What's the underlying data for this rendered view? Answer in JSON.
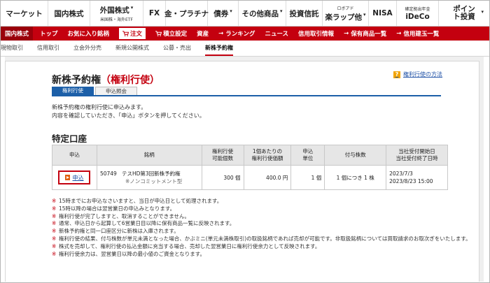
{
  "topnav": [
    {
      "label": "マーケット"
    },
    {
      "label": "国内株式"
    },
    {
      "label": "外国株式",
      "sub": "米国株・海外ETF"
    },
    {
      "label": "FX"
    },
    {
      "label": "金・プラチナ"
    },
    {
      "label": "債券"
    },
    {
      "label": "その他商品"
    },
    {
      "label": "投資信託"
    },
    {
      "label": "楽ラップ他",
      "sub2": "ロボアド"
    },
    {
      "label": "NISA"
    },
    {
      "label": "iDeCo",
      "sub2": "確定拠出年金"
    },
    {
      "label": "ポイント投資"
    }
  ],
  "rednav": {
    "home": "国内株式",
    "items": [
      "トップ",
      "お気に入り銘柄",
      "注文",
      "積立設定",
      "資産",
      "ランキング",
      "ニュース",
      "信用取引情報",
      "保有商品一覧",
      "信用建玉一覧"
    ]
  },
  "subnav": {
    "items": [
      "現物取引",
      "信用取引",
      "立会外分売",
      "新規公開株式",
      "公募・売出",
      "新株予約権"
    ]
  },
  "page": {
    "title_main": "新株予約権",
    "title_accent": "（権利行使）",
    "help_label": "権利行使の方法",
    "tabs": [
      "権利行使",
      "申込照会"
    ],
    "instructions": [
      "新株予約権の権利行使に申込みます。",
      "内容を確認していただき、「申込」ボタンを押してください。"
    ],
    "section_title": "特定口座"
  },
  "table": {
    "headers": {
      "apply": "申込",
      "name": "銘柄",
      "avail_l1": "権利行使",
      "avail_l2": "可能個数",
      "price_l1": "1個あたりの",
      "price_l2": "権利行使価額",
      "unit_l1": "申込",
      "unit_l2": "単位",
      "grant": "付与株数",
      "dates_l1": "当社受付開始日",
      "dates_l2": "当社受付終了日時"
    },
    "row": {
      "apply_label": "申込",
      "code": "50749",
      "name": "テスHD第3回新株予約権",
      "note": "※ノンコミットメント型",
      "avail": "300 個",
      "price": "400.0 円",
      "unit": "1 個",
      "grant": "1 個につき 1 株",
      "start": "2023/7/3",
      "end": "2023/8/23 15:00"
    }
  },
  "notes": [
    "15時までにお申込なさいますと、当日が申込日として処理されます。",
    "15時以降の場合は翌営業日の申込みとなります。",
    "権利行使が完了しますと、取消することができません。",
    "通常、申込日から起算して6営業日目以降に保有商品一覧に反映されます。",
    "新株予約権と同一口座区分に新株は入庫されます。",
    "権利行使の結果、付与株数が単元未満となった場合、かぶミニ(単元未満株取引)の取扱銘柄であれば売却が可能です。非取扱銘柄については買取請求のお取次ぎをいたします。",
    "株式を売却して、権利行使の払込金額に充当する場合、売却した翌営業日に権利行使余力として反映されます。",
    "権利行使余力は、翌営業日以降の最小値のご資金となります。"
  ],
  "note_mark": "※",
  "colors": {
    "brand_red": "#c4000f",
    "tab_blue": "#1c5fa8",
    "link_blue": "#2354a8"
  }
}
